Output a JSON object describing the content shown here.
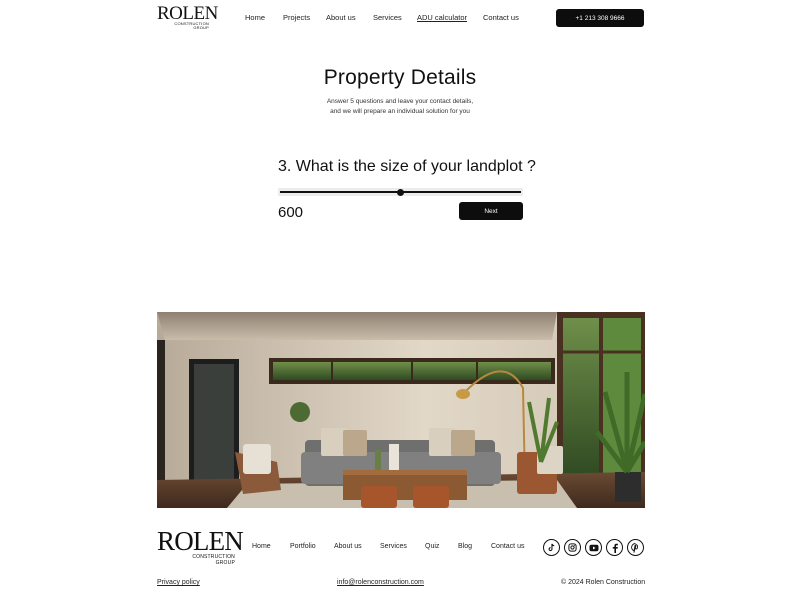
{
  "header": {
    "logo_brand": "ROLEN",
    "logo_sub_line1": "CONSTRUCTION",
    "logo_sub_line2": "GROUP",
    "nav": [
      {
        "label": "Home",
        "active": false
      },
      {
        "label": "Projects",
        "active": false
      },
      {
        "label": "About us",
        "active": false
      },
      {
        "label": "Services",
        "active": false
      },
      {
        "label": "ADU calculator",
        "active": true
      },
      {
        "label": "Contact us",
        "active": false
      }
    ],
    "phone": "+1 213 308 9666"
  },
  "hero": {
    "title": "Property Details",
    "subtitle_line1": "Answer 5 questions and leave your contact details,",
    "subtitle_line2": "and we will prepare an individual solution for you"
  },
  "quiz": {
    "question": "3. What is the size of your landplot ?",
    "slider_fraction": 0.5,
    "value": "600",
    "next_label": "Next"
  },
  "image": {
    "subject": "modern-living-room-interior"
  },
  "footer": {
    "logo_brand": "ROLEN",
    "logo_sub_line1": "CONSTRUCTION",
    "logo_sub_line2": "GROUP",
    "nav": [
      "Home",
      "Portfolio",
      "About us",
      "Services",
      "Quiz",
      "Blog",
      "Contact us"
    ],
    "social_icons": [
      "tiktok-icon",
      "instagram-icon",
      "youtube-icon",
      "facebook-icon",
      "pinterest-icon"
    ],
    "privacy": "Privacy policy",
    "email": "info@rolenconstruction.com",
    "copyright": "© 2024 Rolen Construction"
  },
  "colors": {
    "button_bg": "#0d0d0d",
    "text": "#111111",
    "background": "#ffffff"
  }
}
